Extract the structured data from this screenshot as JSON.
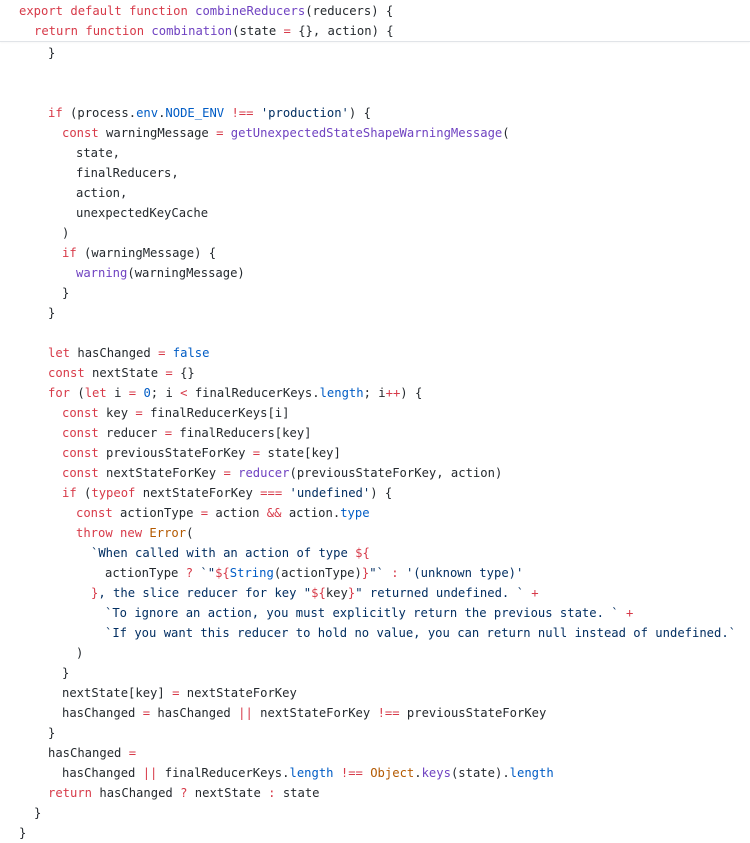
{
  "colors": {
    "keyword": "#d73a49",
    "function": "#6f42c1",
    "string": "#032f62",
    "constant": "#005cc5",
    "class": "#b35900",
    "text": "#24292e",
    "background": "#ffffff"
  },
  "sticky_lines": [
    {
      "indent": 1,
      "tokens": [
        {
          "t": "export ",
          "c": "kw"
        },
        {
          "t": "default ",
          "c": "kw"
        },
        {
          "t": "function ",
          "c": "kw"
        },
        {
          "t": "combineReducers",
          "c": "fn"
        },
        {
          "t": "(reducers) {",
          "c": "plain"
        }
      ]
    },
    {
      "indent": 2,
      "tokens": [
        {
          "t": "return ",
          "c": "kw"
        },
        {
          "t": "function ",
          "c": "kw"
        },
        {
          "t": "combination",
          "c": "fn"
        },
        {
          "t": "(state ",
          "c": "plain"
        },
        {
          "t": "=",
          "c": "kw"
        },
        {
          "t": " {}, action) {",
          "c": "plain"
        }
      ]
    }
  ],
  "code_lines": [
    {
      "indent": 3,
      "tokens": [
        {
          "t": "}",
          "c": "plain"
        }
      ]
    },
    {
      "indent": 0,
      "tokens": []
    },
    {
      "indent": 0,
      "tokens": []
    },
    {
      "indent": 3,
      "tokens": [
        {
          "t": "if ",
          "c": "kw"
        },
        {
          "t": "(process.",
          "c": "plain"
        },
        {
          "t": "env",
          "c": "con"
        },
        {
          "t": ".",
          "c": "plain"
        },
        {
          "t": "NODE_ENV",
          "c": "con"
        },
        {
          "t": " ",
          "c": "plain"
        },
        {
          "t": "!==",
          "c": "kw"
        },
        {
          "t": " ",
          "c": "plain"
        },
        {
          "t": "'production'",
          "c": "str"
        },
        {
          "t": ") {",
          "c": "plain"
        }
      ]
    },
    {
      "indent": 4,
      "tokens": [
        {
          "t": "const ",
          "c": "kw"
        },
        {
          "t": "warningMessage ",
          "c": "plain"
        },
        {
          "t": "=",
          "c": "kw"
        },
        {
          "t": " ",
          "c": "plain"
        },
        {
          "t": "getUnexpectedStateShapeWarningMessage",
          "c": "fn"
        },
        {
          "t": "(",
          "c": "plain"
        }
      ]
    },
    {
      "indent": 5,
      "tokens": [
        {
          "t": "state,",
          "c": "plain"
        }
      ]
    },
    {
      "indent": 5,
      "tokens": [
        {
          "t": "finalReducers,",
          "c": "plain"
        }
      ]
    },
    {
      "indent": 5,
      "tokens": [
        {
          "t": "action,",
          "c": "plain"
        }
      ]
    },
    {
      "indent": 5,
      "tokens": [
        {
          "t": "unexpectedKeyCache",
          "c": "plain"
        }
      ]
    },
    {
      "indent": 4,
      "tokens": [
        {
          "t": ")",
          "c": "plain"
        }
      ]
    },
    {
      "indent": 4,
      "tokens": [
        {
          "t": "if ",
          "c": "kw"
        },
        {
          "t": "(warningMessage) {",
          "c": "plain"
        }
      ]
    },
    {
      "indent": 5,
      "tokens": [
        {
          "t": "warning",
          "c": "fn"
        },
        {
          "t": "(warningMessage)",
          "c": "plain"
        }
      ]
    },
    {
      "indent": 4,
      "tokens": [
        {
          "t": "}",
          "c": "plain"
        }
      ]
    },
    {
      "indent": 3,
      "tokens": [
        {
          "t": "}",
          "c": "plain"
        }
      ]
    },
    {
      "indent": 0,
      "tokens": []
    },
    {
      "indent": 3,
      "tokens": [
        {
          "t": "let ",
          "c": "kw"
        },
        {
          "t": "hasChanged ",
          "c": "plain"
        },
        {
          "t": "=",
          "c": "kw"
        },
        {
          "t": " ",
          "c": "plain"
        },
        {
          "t": "false",
          "c": "con"
        }
      ]
    },
    {
      "indent": 3,
      "tokens": [
        {
          "t": "const ",
          "c": "kw"
        },
        {
          "t": "nextState ",
          "c": "plain"
        },
        {
          "t": "=",
          "c": "kw"
        },
        {
          "t": " {}",
          "c": "plain"
        }
      ]
    },
    {
      "indent": 3,
      "tokens": [
        {
          "t": "for ",
          "c": "kw"
        },
        {
          "t": "(",
          "c": "plain"
        },
        {
          "t": "let ",
          "c": "kw"
        },
        {
          "t": "i ",
          "c": "plain"
        },
        {
          "t": "=",
          "c": "kw"
        },
        {
          "t": " ",
          "c": "plain"
        },
        {
          "t": "0",
          "c": "con"
        },
        {
          "t": "; i ",
          "c": "plain"
        },
        {
          "t": "<",
          "c": "kw"
        },
        {
          "t": " finalReducerKeys.",
          "c": "plain"
        },
        {
          "t": "length",
          "c": "con"
        },
        {
          "t": "; i",
          "c": "plain"
        },
        {
          "t": "++",
          "c": "kw"
        },
        {
          "t": ") {",
          "c": "plain"
        }
      ]
    },
    {
      "indent": 4,
      "tokens": [
        {
          "t": "const ",
          "c": "kw"
        },
        {
          "t": "key ",
          "c": "plain"
        },
        {
          "t": "=",
          "c": "kw"
        },
        {
          "t": " finalReducerKeys[i]",
          "c": "plain"
        }
      ]
    },
    {
      "indent": 4,
      "tokens": [
        {
          "t": "const ",
          "c": "kw"
        },
        {
          "t": "reducer ",
          "c": "plain"
        },
        {
          "t": "=",
          "c": "kw"
        },
        {
          "t": " finalReducers[key]",
          "c": "plain"
        }
      ]
    },
    {
      "indent": 4,
      "tokens": [
        {
          "t": "const ",
          "c": "kw"
        },
        {
          "t": "previousStateForKey ",
          "c": "plain"
        },
        {
          "t": "=",
          "c": "kw"
        },
        {
          "t": " state[key]",
          "c": "plain"
        }
      ]
    },
    {
      "indent": 4,
      "tokens": [
        {
          "t": "const ",
          "c": "kw"
        },
        {
          "t": "nextStateForKey ",
          "c": "plain"
        },
        {
          "t": "=",
          "c": "kw"
        },
        {
          "t": " ",
          "c": "plain"
        },
        {
          "t": "reducer",
          "c": "fn"
        },
        {
          "t": "(previousStateForKey, action)",
          "c": "plain"
        }
      ]
    },
    {
      "indent": 4,
      "tokens": [
        {
          "t": "if ",
          "c": "kw"
        },
        {
          "t": "(",
          "c": "plain"
        },
        {
          "t": "typeof ",
          "c": "kw"
        },
        {
          "t": "nextStateForKey ",
          "c": "plain"
        },
        {
          "t": "===",
          "c": "kw"
        },
        {
          "t": " ",
          "c": "plain"
        },
        {
          "t": "'undefined'",
          "c": "str"
        },
        {
          "t": ") {",
          "c": "plain"
        }
      ]
    },
    {
      "indent": 5,
      "tokens": [
        {
          "t": "const ",
          "c": "kw"
        },
        {
          "t": "actionType ",
          "c": "plain"
        },
        {
          "t": "=",
          "c": "kw"
        },
        {
          "t": " action ",
          "c": "plain"
        },
        {
          "t": "&&",
          "c": "kw"
        },
        {
          "t": " action.",
          "c": "plain"
        },
        {
          "t": "type",
          "c": "con"
        }
      ]
    },
    {
      "indent": 5,
      "tokens": [
        {
          "t": "throw ",
          "c": "kw"
        },
        {
          "t": "new ",
          "c": "kw"
        },
        {
          "t": "Error",
          "c": "cls"
        },
        {
          "t": "(",
          "c": "plain"
        }
      ]
    },
    {
      "indent": 6,
      "tokens": [
        {
          "t": "`When called with an action of type ",
          "c": "str"
        },
        {
          "t": "${",
          "c": "kw"
        }
      ]
    },
    {
      "indent": 7,
      "tokens": [
        {
          "t": "actionType ",
          "c": "plain"
        },
        {
          "t": "?",
          "c": "kw"
        },
        {
          "t": " ",
          "c": "plain"
        },
        {
          "t": "`\"",
          "c": "str"
        },
        {
          "t": "${",
          "c": "kw"
        },
        {
          "t": "String",
          "c": "con"
        },
        {
          "t": "(actionType)",
          "c": "plain"
        },
        {
          "t": "}",
          "c": "kw"
        },
        {
          "t": "\"`",
          "c": "str"
        },
        {
          "t": " ",
          "c": "plain"
        },
        {
          "t": ":",
          "c": "kw"
        },
        {
          "t": " ",
          "c": "plain"
        },
        {
          "t": "'(unknown type)'",
          "c": "str"
        }
      ]
    },
    {
      "indent": 6,
      "tokens": [
        {
          "t": "}",
          "c": "kw"
        },
        {
          "t": ", the slice reducer for key \"",
          "c": "str"
        },
        {
          "t": "${",
          "c": "kw"
        },
        {
          "t": "key",
          "c": "plain"
        },
        {
          "t": "}",
          "c": "kw"
        },
        {
          "t": "\" returned undefined. `",
          "c": "str"
        },
        {
          "t": " ",
          "c": "plain"
        },
        {
          "t": "+",
          "c": "kw"
        }
      ]
    },
    {
      "indent": 7,
      "tokens": [
        {
          "t": "`To ignore an action, you must explicitly return the previous state. `",
          "c": "str"
        },
        {
          "t": " ",
          "c": "plain"
        },
        {
          "t": "+",
          "c": "kw"
        }
      ]
    },
    {
      "indent": 7,
      "tokens": [
        {
          "t": "`If you want this reducer to hold no value, you can return null instead of undefined.`",
          "c": "str"
        }
      ]
    },
    {
      "indent": 5,
      "tokens": [
        {
          "t": ")",
          "c": "plain"
        }
      ]
    },
    {
      "indent": 4,
      "tokens": [
        {
          "t": "}",
          "c": "plain"
        }
      ]
    },
    {
      "indent": 4,
      "tokens": [
        {
          "t": "nextState[key] ",
          "c": "plain"
        },
        {
          "t": "=",
          "c": "kw"
        },
        {
          "t": " nextStateForKey",
          "c": "plain"
        }
      ]
    },
    {
      "indent": 4,
      "tokens": [
        {
          "t": "hasChanged ",
          "c": "plain"
        },
        {
          "t": "=",
          "c": "kw"
        },
        {
          "t": " hasChanged ",
          "c": "plain"
        },
        {
          "t": "||",
          "c": "kw"
        },
        {
          "t": " nextStateForKey ",
          "c": "plain"
        },
        {
          "t": "!==",
          "c": "kw"
        },
        {
          "t": " previousStateForKey",
          "c": "plain"
        }
      ]
    },
    {
      "indent": 3,
      "tokens": [
        {
          "t": "}",
          "c": "plain"
        }
      ]
    },
    {
      "indent": 3,
      "tokens": [
        {
          "t": "hasChanged ",
          "c": "plain"
        },
        {
          "t": "=",
          "c": "kw"
        }
      ]
    },
    {
      "indent": 4,
      "tokens": [
        {
          "t": "hasChanged ",
          "c": "plain"
        },
        {
          "t": "||",
          "c": "kw"
        },
        {
          "t": " finalReducerKeys.",
          "c": "plain"
        },
        {
          "t": "length",
          "c": "con"
        },
        {
          "t": " ",
          "c": "plain"
        },
        {
          "t": "!==",
          "c": "kw"
        },
        {
          "t": " ",
          "c": "plain"
        },
        {
          "t": "Object",
          "c": "cls"
        },
        {
          "t": ".",
          "c": "plain"
        },
        {
          "t": "keys",
          "c": "fn"
        },
        {
          "t": "(state).",
          "c": "plain"
        },
        {
          "t": "length",
          "c": "con"
        }
      ]
    },
    {
      "indent": 3,
      "tokens": [
        {
          "t": "return ",
          "c": "kw"
        },
        {
          "t": "hasChanged ",
          "c": "plain"
        },
        {
          "t": "?",
          "c": "kw"
        },
        {
          "t": " nextState ",
          "c": "plain"
        },
        {
          "t": ":",
          "c": "kw"
        },
        {
          "t": " state",
          "c": "plain"
        }
      ]
    },
    {
      "indent": 2,
      "tokens": [
        {
          "t": "}",
          "c": "plain"
        }
      ]
    },
    {
      "indent": 1,
      "tokens": [
        {
          "t": "}",
          "c": "plain"
        }
      ]
    }
  ]
}
